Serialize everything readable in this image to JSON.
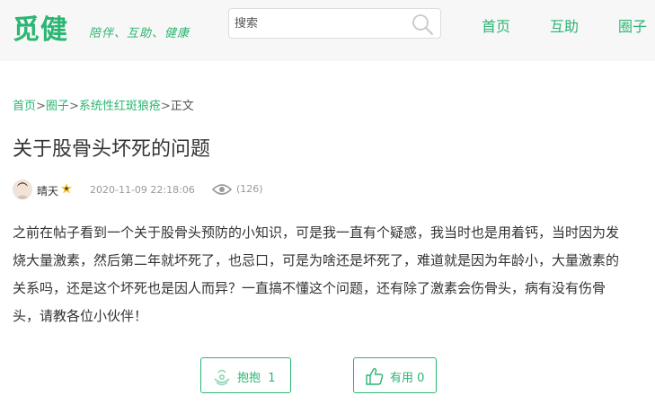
{
  "header": {
    "logo_text": "觅健",
    "slogan": "陪伴、互助、健康",
    "search": {
      "placeholder": "搜索",
      "value": ""
    },
    "nav": [
      {
        "label": "首页"
      },
      {
        "label": "互助"
      },
      {
        "label": "圈子"
      }
    ]
  },
  "breadcrumb": {
    "items": [
      "首页",
      "圈子",
      "系统性红斑狼疮",
      "正文"
    ],
    "separator": ">"
  },
  "post": {
    "title": "关于股骨头坏死的问题",
    "author": "晴天",
    "time": "2020-11-09 22:18:06",
    "views": "(126)",
    "body": "之前在帖子看到一个关于股骨头预防的小知识，可是我一直有个疑惑，我当时也是用着钙，当时因为发烧大量激素，然后第二年就坏死了，也忌口，可是为啥还是坏死了，难道就是因为年龄小，大量激素的关系吗，还是这个坏死也是因人而异？一直搞不懂这个问题，还有除了激素会伤骨头，病有没有伤骨头，请教各位小伙伴！"
  },
  "actions": {
    "hug": {
      "label": "抱抱",
      "count": "1"
    },
    "like": {
      "label": "有用",
      "count": "0"
    }
  },
  "colors": {
    "brand": "#2bb673",
    "text": "#333333",
    "muted": "#999999",
    "header_bg": "#f7f7f7"
  },
  "icons": {
    "search": "search-icon",
    "view": "eye-icon",
    "hug": "hug-icon",
    "like": "thumbs-up-icon",
    "badge": "user-badge-icon"
  }
}
